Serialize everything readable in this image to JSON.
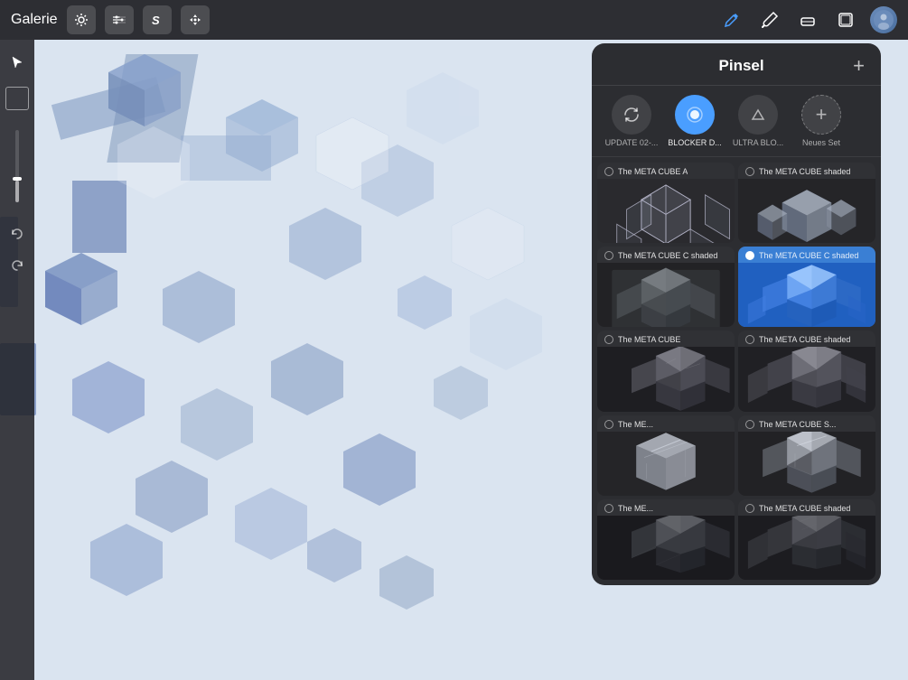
{
  "toolbar": {
    "gallery_label": "Galerie",
    "tools": [
      {
        "name": "settings",
        "icon": "⚙",
        "id": "settings-tool"
      },
      {
        "name": "adjustments",
        "icon": "✦",
        "id": "adjust-tool"
      },
      {
        "name": "smudge",
        "icon": "S",
        "id": "smudge-tool"
      },
      {
        "name": "move",
        "icon": "➤",
        "id": "move-tool"
      }
    ],
    "right_tools": [
      {
        "name": "pen",
        "icon": "✏",
        "active": true,
        "color": "#4a9eff"
      },
      {
        "name": "brush",
        "icon": "🖌",
        "active": false
      },
      {
        "name": "eraser",
        "icon": "⬜",
        "active": false
      },
      {
        "name": "layers",
        "icon": "⬛",
        "active": false
      }
    ]
  },
  "brush_panel": {
    "title": "Pinsel",
    "add_label": "+",
    "tabs": [
      {
        "id": "tab-update",
        "label": "UPDATE 02-...",
        "icon": "✏",
        "active": false
      },
      {
        "id": "tab-blocker",
        "label": "BLOCKER D...",
        "icon": "◉",
        "active": true
      },
      {
        "id": "tab-ultra",
        "label": "ULTRA BLO...",
        "icon": "✏",
        "active": false
      },
      {
        "id": "tab-new",
        "label": "Neues Set",
        "icon": "+",
        "active": false
      }
    ],
    "brushes": [
      {
        "id": "brush-1",
        "name": "The META CUBE A",
        "selected": false,
        "preview_type": "cube_wireframe"
      },
      {
        "id": "brush-2",
        "name": "The META CUBE shaded",
        "selected": false,
        "preview_type": "cube_shaded"
      },
      {
        "id": "brush-3",
        "name": "The META CUBE C shaded",
        "selected": false,
        "preview_type": "cube_rough"
      },
      {
        "id": "brush-4",
        "name": "The META CUBE C shaded",
        "selected": true,
        "preview_type": "cube_blue"
      },
      {
        "id": "brush-5",
        "name": "The META CUBE",
        "selected": false,
        "preview_type": "cube_stone"
      },
      {
        "id": "brush-6",
        "name": "The META CUBE shaded",
        "selected": false,
        "preview_type": "cube_stone2"
      },
      {
        "id": "brush-7",
        "name": "The ME...",
        "selected": false,
        "preview_type": "cube_silver"
      },
      {
        "id": "brush-8",
        "name": "The META CUBE S...",
        "selected": false,
        "preview_type": "cube_silver2"
      },
      {
        "id": "brush-9",
        "name": "The ME...",
        "selected": false,
        "preview_type": "cube_dark"
      },
      {
        "id": "brush-10",
        "name": "The META CUBE shaded",
        "selected": false,
        "preview_type": "cube_dark2"
      }
    ]
  },
  "sidebar": {
    "icons": [
      {
        "name": "cursor",
        "icon": "↖",
        "active": true
      },
      {
        "name": "square",
        "icon": "□",
        "active": false
      }
    ]
  },
  "colors": {
    "toolbar_bg": "rgba(30,30,35,0.92)",
    "panel_bg": "rgba(38,38,42,0.97)",
    "active_blue": "#4a9eff",
    "selected_blue": "#3a7fd4"
  }
}
